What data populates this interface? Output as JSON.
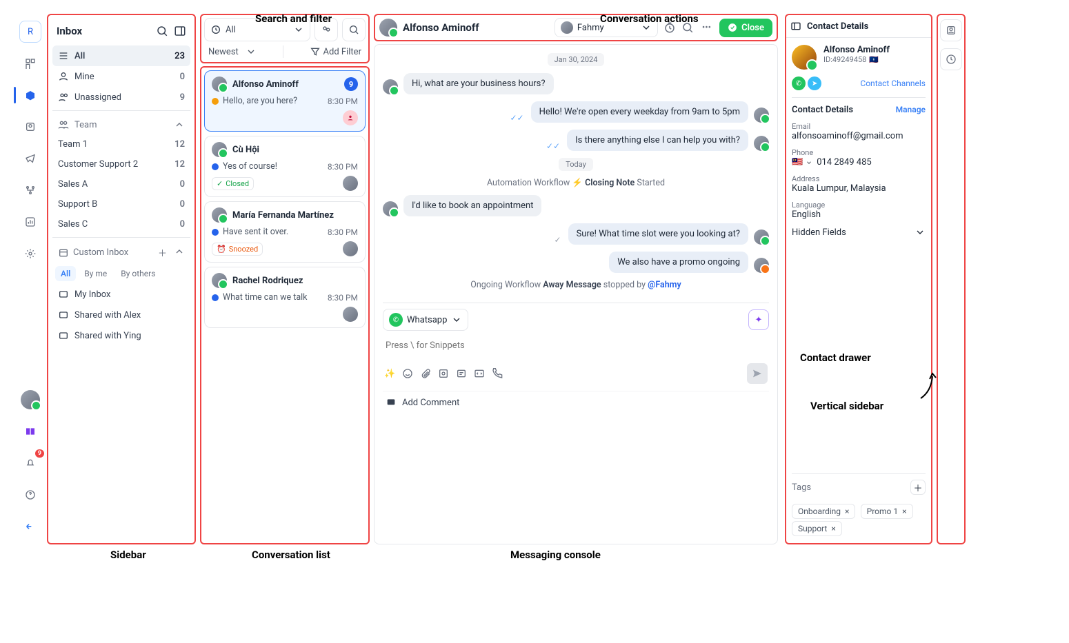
{
  "annotations": {
    "search_filter": "Search and filter",
    "conv_actions": "Conversation actions",
    "sidebar": "Sidebar",
    "conv_list": "Conversation list",
    "messaging": "Messaging console",
    "contact_drawer": "Contact drawer",
    "vertical_sidebar": "Vertical sidebar"
  },
  "rail": {
    "logo": "R",
    "notif_count": "9"
  },
  "sidebar": {
    "title": "Inbox",
    "nav": [
      {
        "label": "All",
        "count": "23"
      },
      {
        "label": "Mine",
        "count": "0"
      },
      {
        "label": "Unassigned",
        "count": "9"
      }
    ],
    "team_header": "Team",
    "teams": [
      {
        "label": "Team 1",
        "count": "12"
      },
      {
        "label": "Customer Support 2",
        "count": "12"
      },
      {
        "label": "Sales A",
        "count": "0"
      },
      {
        "label": "Support B",
        "count": "0"
      },
      {
        "label": "Sales C",
        "count": "0"
      }
    ],
    "custom_title": "Custom Inbox",
    "custom_tabs": [
      "All",
      "By me",
      "By others"
    ],
    "custom_items": [
      "My Inbox",
      "Shared with Alex",
      "Shared with Ying"
    ]
  },
  "filter": {
    "dropdown": "All",
    "sort": "Newest",
    "add_filter": "Add Filter"
  },
  "conversations": [
    {
      "name": "Alfonso Aminoff",
      "preview": "Hello, are you here?",
      "time": "8:30 PM",
      "unread": "9"
    },
    {
      "name": "Cù Hội",
      "preview": "Yes of course!",
      "time": "8:30 PM",
      "status": "Closed"
    },
    {
      "name": "María Fernanda Martínez",
      "preview": "Have sent it over.",
      "time": "8:30 PM",
      "status": "Snoozed"
    },
    {
      "name": "Rachel Rodriquez",
      "preview": "What time can we talk",
      "time": "8:30 PM"
    }
  ],
  "chat": {
    "header_name": "Alfonso Aminoff",
    "assignee": "Fahmy",
    "close_label": "Close",
    "date1": "Jan 30, 2024",
    "m1": "Hi, what are your business hours?",
    "m2": "Hello! We're open every weekday from 9am to 5pm",
    "m3": "Is there anything else I can help you with?",
    "date2": "Today",
    "sys1_pre": "Automation Workflow",
    "sys1_name": "Closing Note",
    "sys1_post": "Started",
    "m4": "I'd like to book an appointment",
    "m5": "Sure! What time slot were you looking at?",
    "m6": "We also have a promo ongoing",
    "sys2_pre": "Ongoing Workflow",
    "sys2_name": "Away Message",
    "sys2_mid": "stopped by",
    "sys2_user": "@Fahmy",
    "channel": "Whatsapp",
    "placeholder": "Press \\ for Snippets",
    "add_comment": "Add Comment"
  },
  "contact": {
    "title": "Contact Details",
    "name": "Alfonso Aminoff",
    "id_label": "ID:49249458",
    "channels_link": "Contact Channels",
    "details_label": "Contact Details",
    "manage": "Manage",
    "email_label": "Email",
    "email": "alfonsoaminoff@gmail.com",
    "phone_label": "Phone",
    "phone": "014 2849 485",
    "address_label": "Address",
    "address": "Kuala Lumpur, Malaysia",
    "language_label": "Language",
    "language": "English",
    "hidden_fields": "Hidden Fields",
    "tags_label": "Tags",
    "tags": [
      "Onboarding",
      "Promo 1",
      "Support"
    ]
  }
}
